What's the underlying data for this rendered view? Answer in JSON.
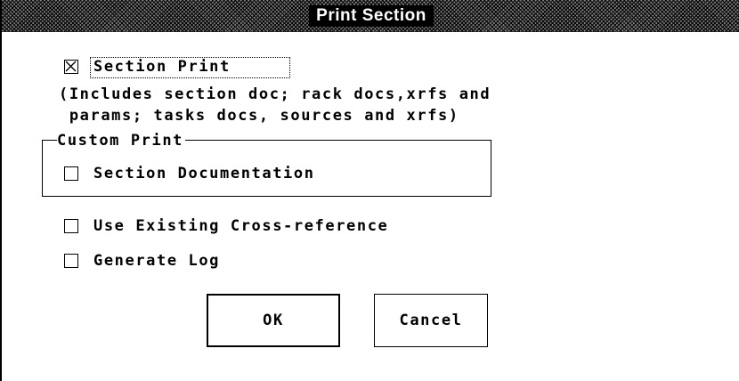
{
  "dialog": {
    "title": "Print Section"
  },
  "section_print": {
    "label": "Section Print",
    "checked": true,
    "description_line1": "(Includes section doc; rack docs,xrfs and",
    "description_line2": " params; tasks docs, sources and xrfs)"
  },
  "custom_print": {
    "legend": "Custom Print",
    "section_documentation": {
      "label": "Section Documentation",
      "checked": false
    }
  },
  "options": {
    "use_existing_xref": {
      "label": "Use Existing Cross-reference",
      "checked": false
    },
    "generate_log": {
      "label": "Generate Log",
      "checked": false
    }
  },
  "buttons": {
    "ok_label": "OK",
    "cancel_label": "Cancel"
  }
}
